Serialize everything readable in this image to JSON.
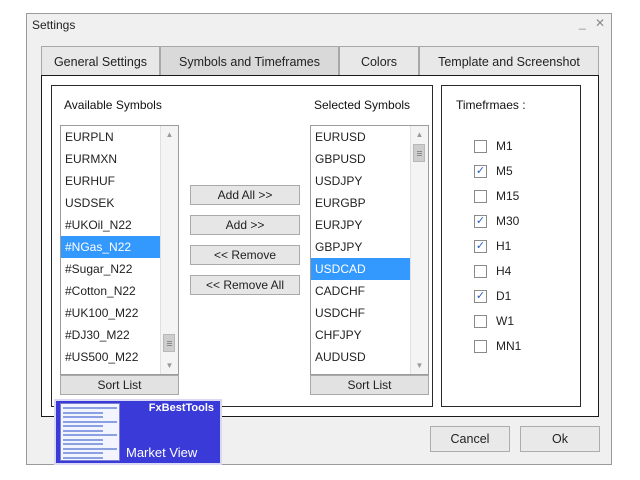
{
  "window": {
    "title": "Settings",
    "minimize_glyph": "_",
    "close_glyph": "✕"
  },
  "tabs": [
    {
      "label": "General Settings",
      "active": false
    },
    {
      "label": "Symbols and Timeframes",
      "active": true
    },
    {
      "label": "Colors",
      "active": false
    },
    {
      "label": "Template and Screenshot",
      "active": false
    }
  ],
  "available": {
    "label": "Available Symbols",
    "items": [
      "EURPLN",
      "EURMXN",
      "EURHUF",
      "USDSEK",
      "#UKOil_N22",
      "#NGas_N22",
      "#Sugar_N22",
      "#Cotton_N22",
      "#UK100_M22",
      "#DJ30_M22",
      "#US500_M22"
    ],
    "selected_index": 5,
    "sort_label": "Sort List"
  },
  "selected": {
    "label": "Selected Symbols",
    "items": [
      "EURUSD",
      "GBPUSD",
      "USDJPY",
      "EURGBP",
      "EURJPY",
      "GBPJPY",
      "USDCAD",
      "CADCHF",
      "USDCHF",
      "CHFJPY",
      "AUDUSD"
    ],
    "selected_index": 6,
    "sort_label": "Sort List"
  },
  "transfer_buttons": {
    "add_all": "Add All >>",
    "add": "Add >>",
    "remove": "<< Remove",
    "remove_all": "<< Remove All"
  },
  "timeframes": {
    "label": "Timefrmaes :",
    "items": [
      {
        "name": "M1",
        "checked": false
      },
      {
        "name": "M5",
        "checked": true
      },
      {
        "name": "M15",
        "checked": false
      },
      {
        "name": "M30",
        "checked": true
      },
      {
        "name": "H1",
        "checked": true
      },
      {
        "name": "H4",
        "checked": false
      },
      {
        "name": "D1",
        "checked": true
      },
      {
        "name": "W1",
        "checked": false
      },
      {
        "name": "MN1",
        "checked": false
      }
    ]
  },
  "dialog_buttons": {
    "cancel": "Cancel",
    "ok": "Ok"
  },
  "overlay": {
    "brand": "FxBestTools",
    "caption": "Market View"
  },
  "colors": {
    "selection": "#3399ff",
    "overlay_bg": "#3a3ad8",
    "check": "#2860c0"
  }
}
